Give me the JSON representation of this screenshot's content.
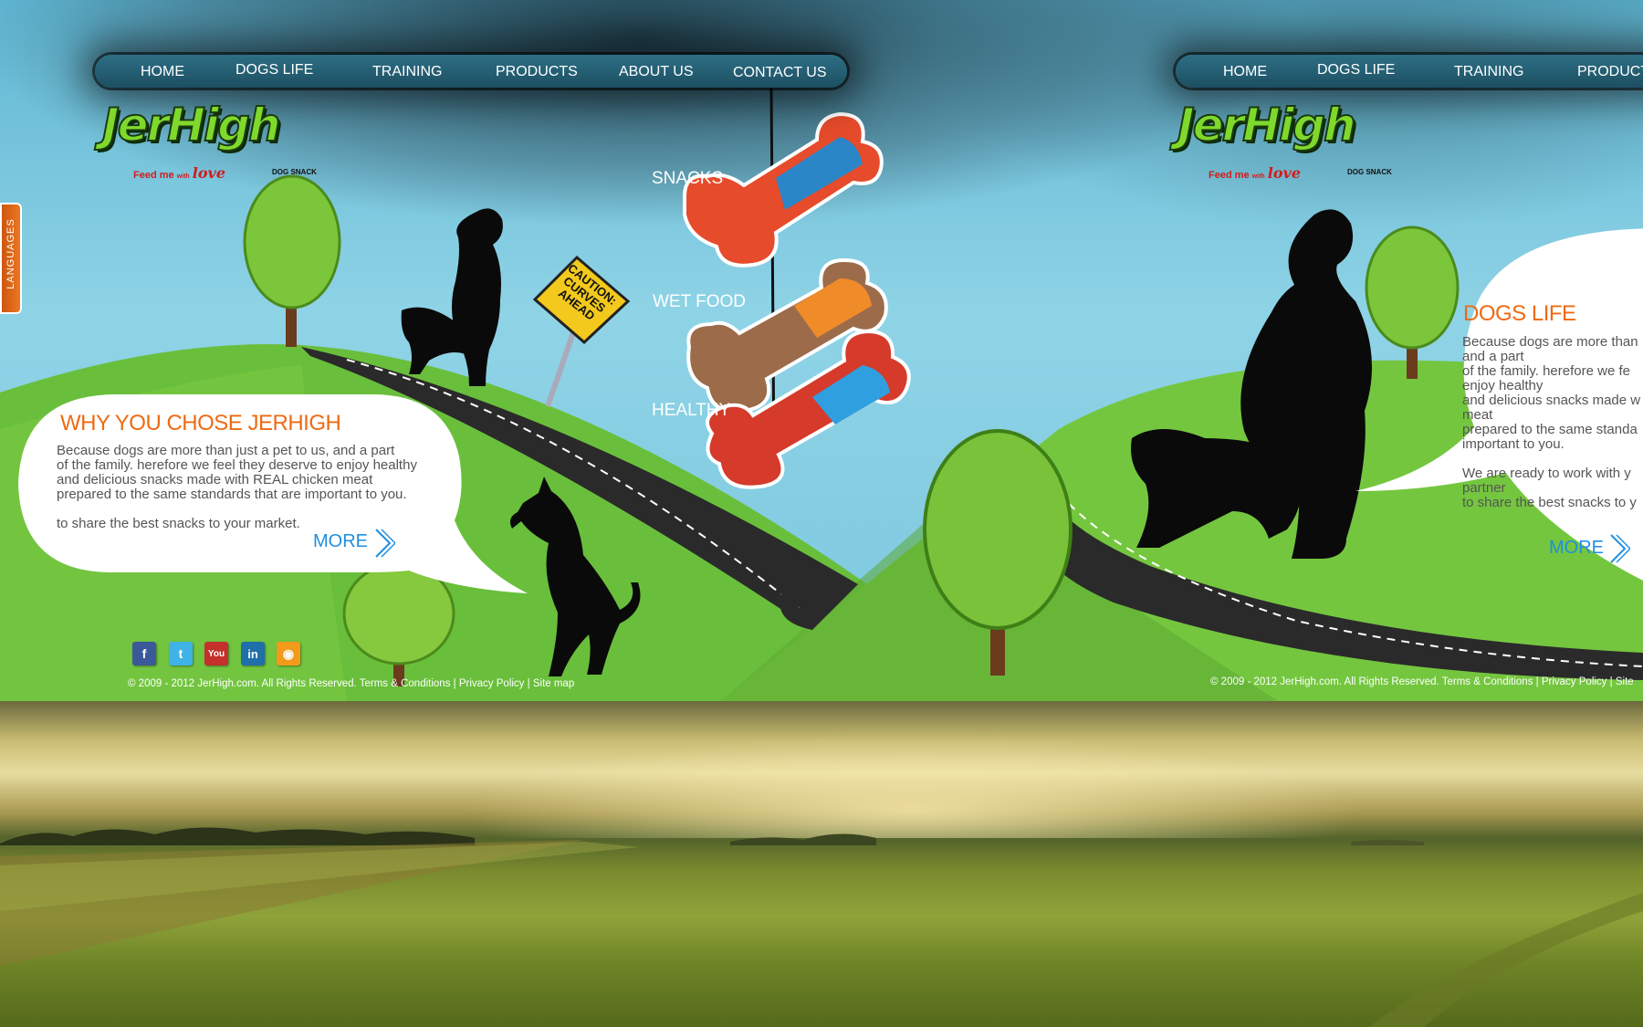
{
  "nav": {
    "items": [
      "HOME",
      "DOGS LIFE",
      "TRAINING",
      "PRODUCTS",
      "ABOUT US",
      "CONTACT US"
    ],
    "right_items": [
      "HOME",
      "DOGS LIFE",
      "TRAINING",
      "PRODUCT"
    ]
  },
  "brand": {
    "name": "JerHigh",
    "tagline_1": "Feed me",
    "tagline_2": "with",
    "tagline_3": "love",
    "badge": "DOG SNACK"
  },
  "languages_tab": "LANGUAGES",
  "sign": {
    "line1": "CAUTION:",
    "line2": "CURVES",
    "line3": "AHEAD"
  },
  "categories": [
    "SNACKS",
    "WET FOOD",
    "HEALTHY"
  ],
  "left_panel": {
    "title": "WHY YOU CHOSE JERHIGH",
    "body": "Because dogs are more than just a pet to us, and a part\nof the family. herefore we feel they deserve to enjoy healthy\nand delicious snacks made with REAL chicken meat\nprepared to the same standards that are important to you.\n\nto share the best snacks to your market.",
    "more": "MORE"
  },
  "right_panel": {
    "title": "DOGS LIFE",
    "body": "Because dogs are more than\nand a part\nof the family. herefore we fe\nenjoy healthy\nand delicious snacks made w\nmeat\nprepared to the same standa\nimportant to you.\n\nWe are ready to work with y\npartner\nto share the best snacks to y",
    "more": "MORE"
  },
  "social": [
    {
      "name": "facebook-icon",
      "glyph": "f",
      "color": "#3b5998"
    },
    {
      "name": "twitter-icon",
      "glyph": "t",
      "color": "#3fb3e8"
    },
    {
      "name": "youtube-icon",
      "glyph": "You",
      "color": "#c4302b"
    },
    {
      "name": "linkedin-icon",
      "glyph": "in",
      "color": "#1f6fa8"
    },
    {
      "name": "rss-icon",
      "glyph": "◉",
      "color": "#f39a1b"
    }
  ],
  "footer": {
    "copyright": "© 2009 - 2012 JerHigh.com. All Rights Reserved.",
    "terms": "Terms & Conditions",
    "privacy": "Privacy Policy",
    "sitemap": "Site map",
    "sitemap_cut": "Site",
    "sep": "|"
  },
  "colors": {
    "accent_orange": "#ee6a12",
    "link_blue": "#1f8fe0",
    "grass": "#6cc23a",
    "road": "#2a2a2a"
  }
}
